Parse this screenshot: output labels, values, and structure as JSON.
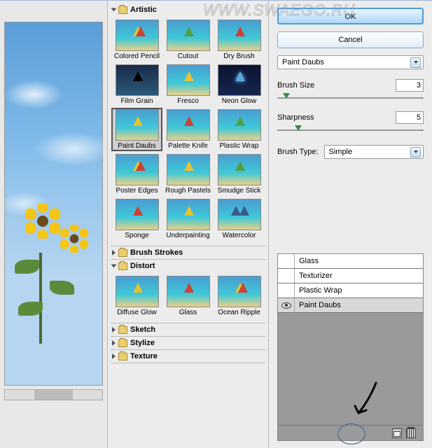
{
  "watermark": "WWW.SWAEGO.RU",
  "buttons": {
    "ok": "OK",
    "cancel": "Cancel"
  },
  "filter_select": {
    "value": "Paint Daubs"
  },
  "sliders": {
    "brush_size": {
      "label": "Brush Size",
      "value": "3"
    },
    "sharpness": {
      "label": "Sharpness",
      "value": "5"
    }
  },
  "brush_type": {
    "label": "Brush Type:",
    "value": "Simple"
  },
  "categories": {
    "artistic": {
      "name": "Artistic",
      "items": [
        "Colored Pencil",
        "Cutout",
        "Dry Brush",
        "Film Grain",
        "Fresco",
        "Neon Glow",
        "Paint Daubs",
        "Palette Knife",
        "Plastic Wrap",
        "Poster Edges",
        "Rough Pastels",
        "Smudge Stick",
        "Sponge",
        "Underpainting",
        "Watercolor"
      ]
    },
    "brush_strokes": {
      "name": "Brush Strokes"
    },
    "distort": {
      "name": "Distort",
      "items": [
        "Diffuse Glow",
        "Glass",
        "Ocean Ripple"
      ]
    },
    "sketch": {
      "name": "Sketch"
    },
    "stylize": {
      "name": "Stylize"
    },
    "texture": {
      "name": "Texture"
    }
  },
  "layers": [
    {
      "name": "Glass",
      "visible": false
    },
    {
      "name": "Texturizer",
      "visible": false
    },
    {
      "name": "Plastic Wrap",
      "visible": false
    },
    {
      "name": "Paint Daubs",
      "visible": true
    }
  ]
}
